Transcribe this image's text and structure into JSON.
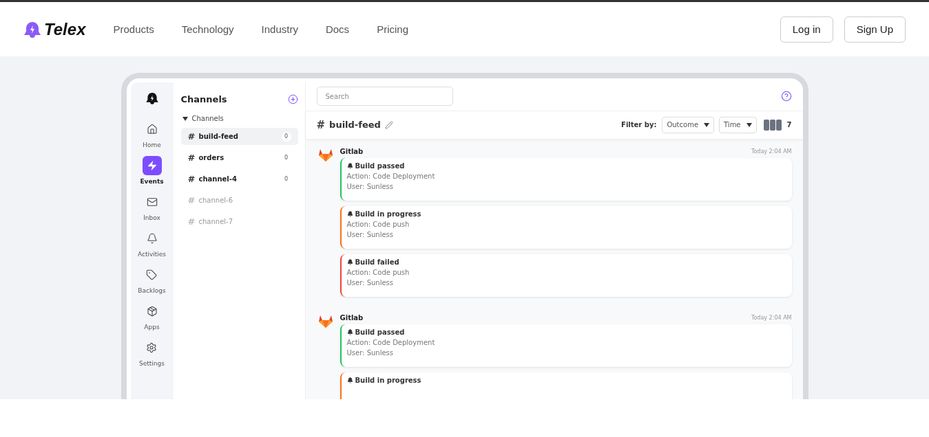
{
  "nav": {
    "brand": "Telex",
    "links": [
      "Products",
      "Technology",
      "Industry",
      "Docs",
      "Pricing"
    ],
    "buttons": [
      "Log in",
      "Sign Up"
    ]
  },
  "rail": [
    {
      "kind": "home",
      "label": "Home",
      "selected": false
    },
    {
      "kind": "events",
      "label": "Events",
      "selected": true
    },
    {
      "kind": "inbox",
      "label": "Inbox",
      "selected": false
    },
    {
      "kind": "activities",
      "label": "Activities",
      "selected": false
    },
    {
      "kind": "backlogs",
      "label": "Backlogs",
      "selected": false
    },
    {
      "kind": "apps",
      "label": "Apps",
      "selected": false
    },
    {
      "kind": "settings",
      "label": "Settings",
      "selected": false
    }
  ],
  "channels_panel": {
    "title": "Channels",
    "section": "Channels",
    "expanded": true,
    "items": [
      {
        "hash": "#",
        "name": "build-feed",
        "count": "0",
        "selected": true,
        "muted": false
      },
      {
        "hash": "#",
        "name": "orders",
        "count": "0",
        "selected": false,
        "muted": false
      },
      {
        "hash": "#",
        "name": "channel-4",
        "count": "0",
        "selected": false,
        "muted": false
      },
      {
        "hash": "#",
        "name": "channel-6",
        "selected": false,
        "muted": true
      },
      {
        "hash": "#",
        "name": "channel-7",
        "selected": false,
        "muted": true
      }
    ]
  },
  "main": {
    "search": {
      "placeholder": "Search"
    },
    "channel": {
      "hash": "#",
      "name": "build-feed"
    },
    "filter_label": "Filter by:",
    "filters": [
      "Outcome",
      "Time"
    ],
    "member_count": "7",
    "groups": [
      {
        "source": "Gitlab",
        "time": "Today 2:04 AM",
        "events": [
          {
            "title": "Build passed",
            "lines": [
              "Action: Code Deployment",
              "User: Sunless"
            ],
            "color": "#22c55e"
          },
          {
            "title": "Build in progress",
            "lines": [
              "Action: Code push",
              "User: Sunless"
            ],
            "color": "#f97316"
          },
          {
            "title": "Build failed",
            "lines": [
              "Action: Code push",
              "User: Sunless"
            ],
            "color": "#ef4444"
          }
        ]
      },
      {
        "source": "Gitlab",
        "time": "Today 2:04 AM",
        "events": [
          {
            "title": "Build passed",
            "lines": [
              "Action: Code Deployment",
              "User: Sunless"
            ],
            "color": "#22c55e"
          },
          {
            "title": "Build in progress",
            "color": "#f97316"
          }
        ]
      }
    ]
  }
}
